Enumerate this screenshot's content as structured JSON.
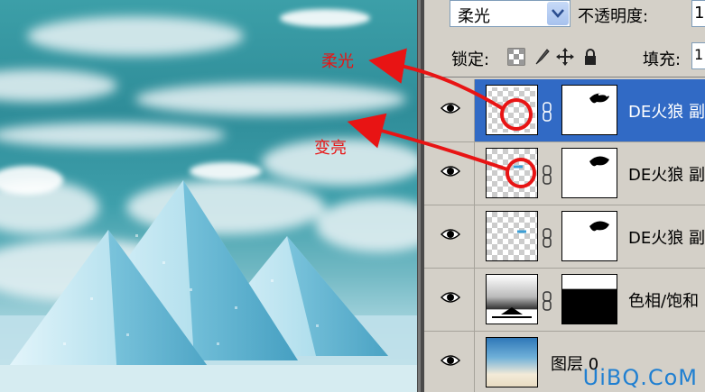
{
  "panel": {
    "blend_mode": "柔光",
    "opacity_label": "不透明度:",
    "opacity_value": "1",
    "lock_label": "锁定:",
    "fill_label": "填充:",
    "fill_value": "1"
  },
  "layers": [
    {
      "name": "DE火狼 副",
      "selected": true
    },
    {
      "name": "DE火狼 副",
      "selected": false
    },
    {
      "name": "DE火狼 副",
      "selected": false
    },
    {
      "name": "色相/饱和",
      "selected": false
    },
    {
      "name": "图层 0",
      "selected": false
    }
  ],
  "annotations": {
    "soft_light": "柔光",
    "lighten": "变亮"
  },
  "watermark": "UiBQ.CoM",
  "colors": {
    "selection": "#316ac5",
    "annotation": "#e81414",
    "panel_bg": "#d4d0c8",
    "watermark": "#1f7fd1"
  },
  "icons": [
    "eye-icon",
    "chain-icon",
    "lock-transparency-icon",
    "lock-paint-icon",
    "lock-move-icon",
    "lock-all-icon",
    "dropdown-arrow-icon"
  ]
}
